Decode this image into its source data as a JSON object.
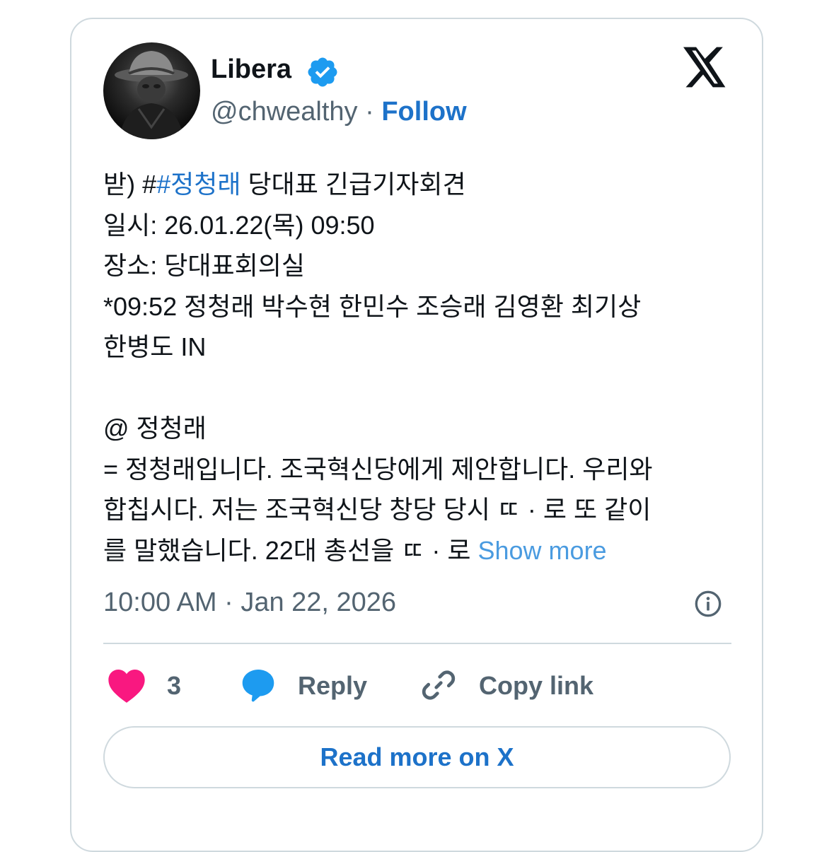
{
  "author": {
    "name": "Libera",
    "handle": "@chwealthy",
    "separator": "·",
    "follow_label": "Follow",
    "verified": true
  },
  "tweet": {
    "lines": [
      {
        "prefix": "받) #",
        "hashtag": "#정청래",
        "suffix": " 당대표 긴급기자회견"
      },
      {
        "text": "일시: 26.01.22(목) 09:50"
      },
      {
        "text": "장소: 당대표회의실"
      },
      {
        "text": "*09:52 정청래 박수현 한민수 조승래 김영환 최기상"
      },
      {
        "text": "한병도 IN"
      },
      {
        "text": ""
      },
      {
        "text": "@ 정청래"
      },
      {
        "text": "= 정청래입니다. 조국혁신당에게 제안합니다. 우리와"
      },
      {
        "text": "합칩시다. 저는 조국혁신당 창당 당시 ㄸ · 로 또 같이"
      },
      {
        "text": "를 말했습니다. 22대 총선을 ㄸ · 로 "
      }
    ],
    "show_more_label": "Show more",
    "timestamp": "10:00 AM · Jan 22, 2026"
  },
  "actions": {
    "like_count": "3",
    "reply_label": "Reply",
    "copy_link_label": "Copy link"
  },
  "read_more_label": "Read more on X",
  "colors": {
    "accent": "#1d72c9",
    "show_more": "#4a9be0",
    "muted": "#536471",
    "heart": "#f91880",
    "verified": "#1d9bf0",
    "border": "#cfd9de"
  },
  "icons": [
    "verified-badge-icon",
    "x-logo-icon",
    "info-icon",
    "heart-icon",
    "reply-icon",
    "link-icon"
  ]
}
